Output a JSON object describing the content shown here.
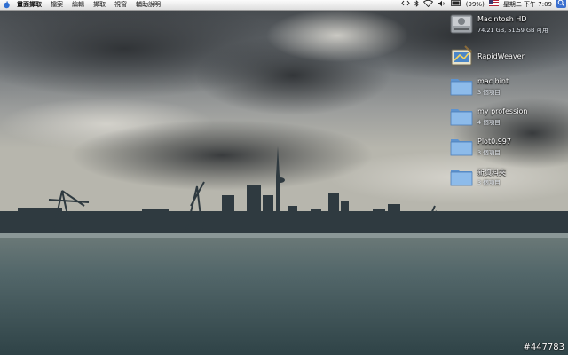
{
  "menubar": {
    "app_name": "畫面擷取",
    "menus": [
      "檔案",
      "編輯",
      "擷取",
      "視窗",
      "輔助說明"
    ],
    "status": {
      "battery": "(99%)",
      "datetime": "星期二 下午 7:09"
    },
    "icons": [
      "apple-icon",
      "script-icon",
      "bluetooth-icon",
      "wifi-icon",
      "volume-icon",
      "battery-icon",
      "flag-icon",
      "spotlight-icon"
    ]
  },
  "desktop": {
    "items": [
      {
        "name": "Macintosh HD",
        "sub": "74.21 GB, 51.59 GB 可用",
        "icon": "hard-drive-icon"
      },
      {
        "name": "RapidWeaver",
        "sub": "",
        "icon": "app-icon"
      },
      {
        "name": "mac hint",
        "sub": "3 個項目",
        "icon": "folder-icon"
      },
      {
        "name": "my profession",
        "sub": "4 個項目",
        "icon": "folder-icon"
      },
      {
        "name": "Plot0.997",
        "sub": "3 個項目",
        "icon": "folder-icon"
      },
      {
        "name": "新資料夾",
        "sub": "3 個項目",
        "icon": "folder-icon"
      }
    ]
  },
  "watermark": "#447783",
  "colors": {
    "menubar": "#e9e9e9",
    "folder_blue": "#7fb2e5",
    "sky": "#8a8f94",
    "water": "#4b5d62"
  }
}
